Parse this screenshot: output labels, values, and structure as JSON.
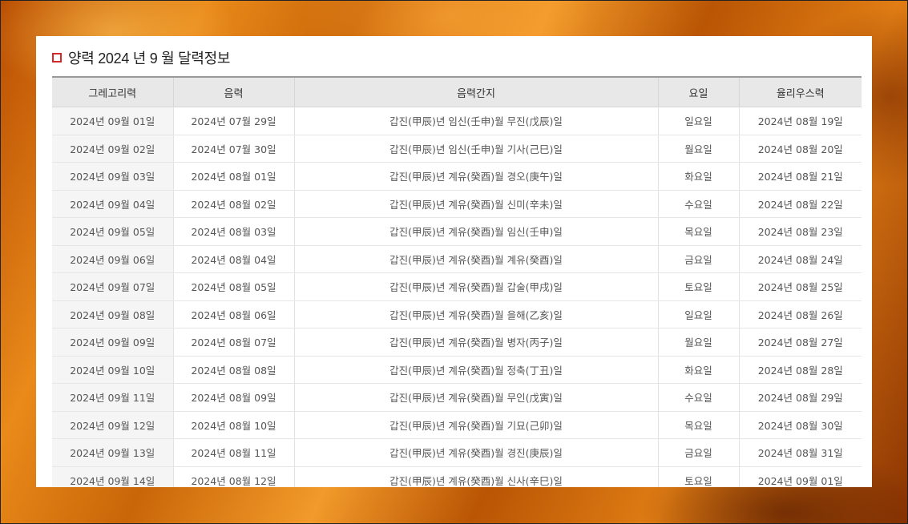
{
  "title": "양력 2024 년 9 월 달력정보",
  "columns": [
    "그레고리력",
    "음력",
    "음력간지",
    "요일",
    "율리우스력"
  ],
  "rows": [
    [
      "2024년 09월 01일",
      "2024년 07월 29일",
      "갑진(甲辰)년 임신(壬申)월 무진(戊辰)일",
      "일요일",
      "2024년 08월 19일"
    ],
    [
      "2024년 09월 02일",
      "2024년 07월 30일",
      "갑진(甲辰)년 임신(壬申)월 기사(己巳)일",
      "월요일",
      "2024년 08월 20일"
    ],
    [
      "2024년 09월 03일",
      "2024년 08월 01일",
      "갑진(甲辰)년 계유(癸酉)월 경오(庚午)일",
      "화요일",
      "2024년 08월 21일"
    ],
    [
      "2024년 09월 04일",
      "2024년 08월 02일",
      "갑진(甲辰)년 계유(癸酉)월 신미(辛未)일",
      "수요일",
      "2024년 08월 22일"
    ],
    [
      "2024년 09월 05일",
      "2024년 08월 03일",
      "갑진(甲辰)년 계유(癸酉)월 임신(壬申)일",
      "목요일",
      "2024년 08월 23일"
    ],
    [
      "2024년 09월 06일",
      "2024년 08월 04일",
      "갑진(甲辰)년 계유(癸酉)월 계유(癸酉)일",
      "금요일",
      "2024년 08월 24일"
    ],
    [
      "2024년 09월 07일",
      "2024년 08월 05일",
      "갑진(甲辰)년 계유(癸酉)월 갑술(甲戌)일",
      "토요일",
      "2024년 08월 25일"
    ],
    [
      "2024년 09월 08일",
      "2024년 08월 06일",
      "갑진(甲辰)년 계유(癸酉)월 을해(乙亥)일",
      "일요일",
      "2024년 08월 26일"
    ],
    [
      "2024년 09월 09일",
      "2024년 08월 07일",
      "갑진(甲辰)년 계유(癸酉)월 병자(丙子)일",
      "월요일",
      "2024년 08월 27일"
    ],
    [
      "2024년 09월 10일",
      "2024년 08월 08일",
      "갑진(甲辰)년 계유(癸酉)월 정축(丁丑)일",
      "화요일",
      "2024년 08월 28일"
    ],
    [
      "2024년 09월 11일",
      "2024년 08월 09일",
      "갑진(甲辰)년 계유(癸酉)월 무인(戊寅)일",
      "수요일",
      "2024년 08월 29일"
    ],
    [
      "2024년 09월 12일",
      "2024년 08월 10일",
      "갑진(甲辰)년 계유(癸酉)월 기묘(己卯)일",
      "목요일",
      "2024년 08월 30일"
    ],
    [
      "2024년 09월 13일",
      "2024년 08월 11일",
      "갑진(甲辰)년 계유(癸酉)월 경진(庚辰)일",
      "금요일",
      "2024년 08월 31일"
    ],
    [
      "2024년 09월 14일",
      "2024년 08월 12일",
      "갑진(甲辰)년 계유(癸酉)월 신사(辛巳)일",
      "토요일",
      "2024년 09월 01일"
    ]
  ],
  "colors": {
    "accent": "#d8262b",
    "header_bg": "#e8e8e8",
    "first_col_bg": "#f5f5f5"
  }
}
